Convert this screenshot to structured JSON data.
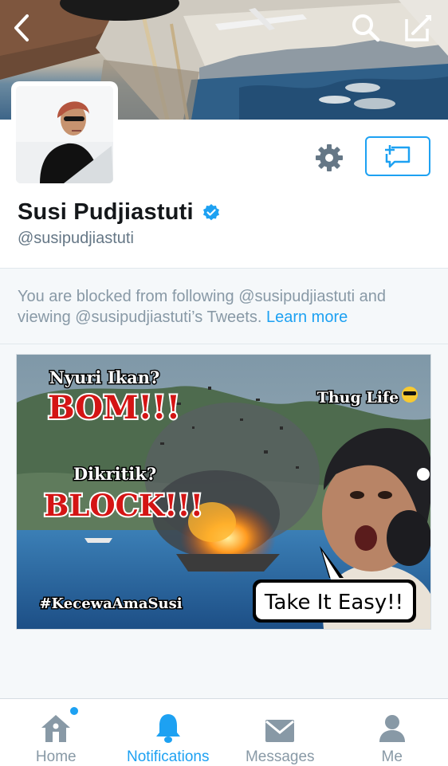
{
  "header": {
    "back_icon": "chevron-left-icon",
    "search_icon": "search-icon",
    "compose_icon": "compose-icon"
  },
  "profile": {
    "name": "Susi Pudjiastuti",
    "handle": "@susipudjiastuti",
    "verified": true,
    "settings_icon": "gear-icon",
    "message_icon": "direct-message-icon"
  },
  "notice": {
    "text": "You are blocked from following @susipudjiastuti and viewing @susipudjiastuti’s Tweets.",
    "link": "Learn more"
  },
  "media": {
    "line1": "Nyuri Ikan?",
    "line2": "BOM!!!",
    "line3": "Dikritik?",
    "line4": "BLOCK!!!",
    "tag": "Thug Life",
    "hashtag": "#KecewaAmaSusi",
    "bubble": "Take It Easy!!"
  },
  "tabs": [
    {
      "label": "Home",
      "icon": "home-icon",
      "active": false,
      "badge": true
    },
    {
      "label": "Notifications",
      "icon": "bell-icon",
      "active": true,
      "badge": false
    },
    {
      "label": "Messages",
      "icon": "envelope-icon",
      "active": false,
      "badge": false
    },
    {
      "label": "Me",
      "icon": "person-icon",
      "active": false,
      "badge": false
    }
  ],
  "colors": {
    "accent": "#1da1f2",
    "text": "#14171a",
    "muted": "#8899a6",
    "background": "#f5f8fa"
  }
}
